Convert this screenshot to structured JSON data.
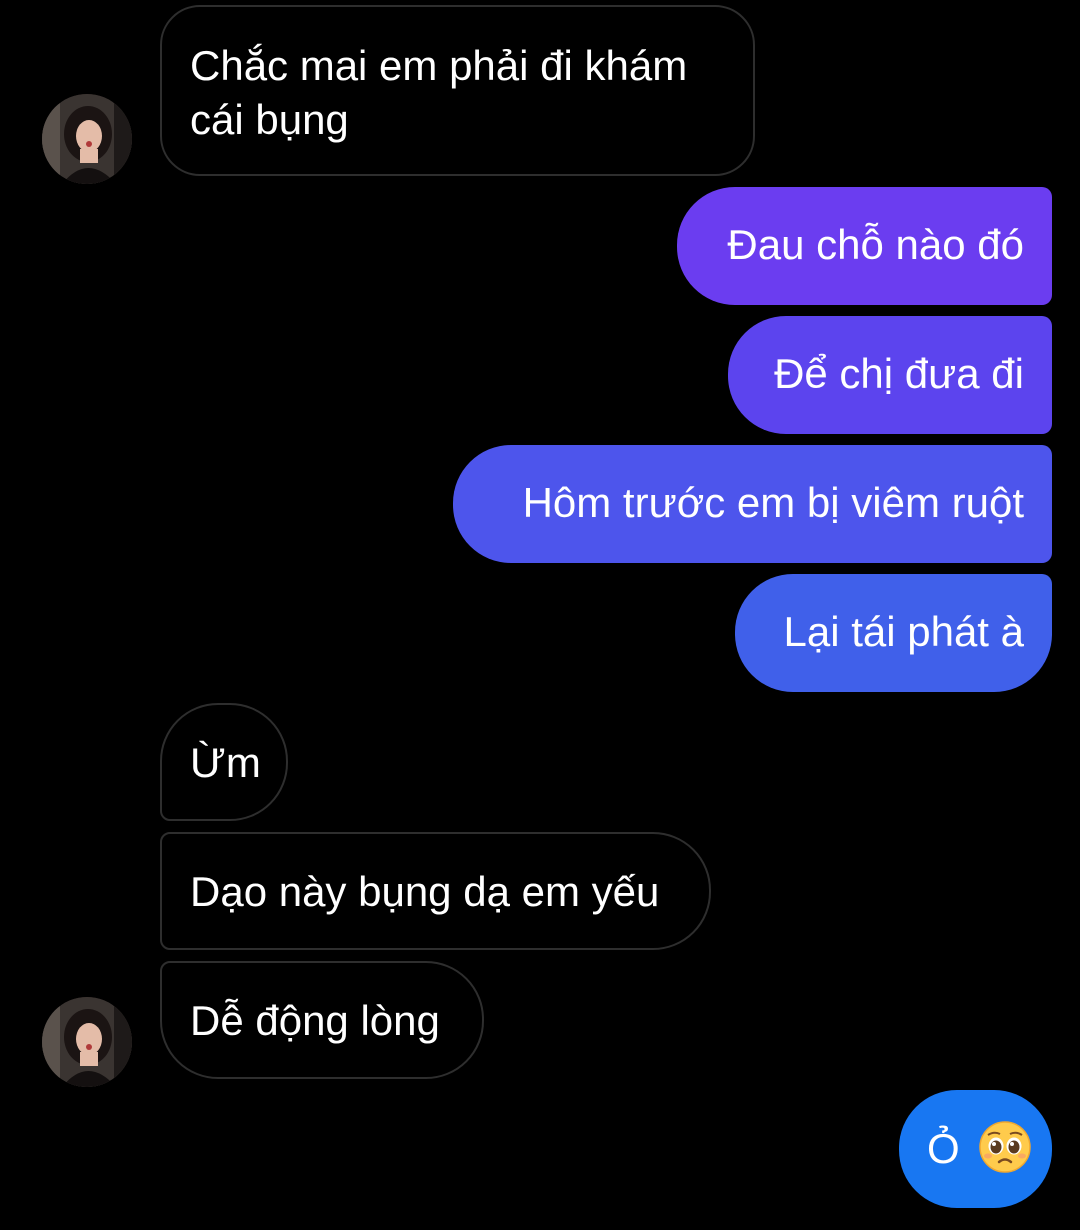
{
  "messages": [
    {
      "dir": "in",
      "text": "Chắc mai em phải đi khám cái bụng",
      "line1": "Chắc mai em phải đi khám",
      "line2": "cái bụng"
    },
    {
      "dir": "out",
      "text": "Đau chỗ nào đó"
    },
    {
      "dir": "out",
      "text": "Để chị đưa đi"
    },
    {
      "dir": "out",
      "text": "Hôm trước em bị viêm ruột"
    },
    {
      "dir": "out",
      "text": "Lại tái phát à"
    },
    {
      "dir": "in",
      "text": "Ừm"
    },
    {
      "dir": "in",
      "text": "Dạo này bụng dạ em yếu"
    },
    {
      "dir": "in",
      "text": "Dễ động lòng"
    },
    {
      "dir": "out",
      "text": "Ỏ",
      "emoji": "🥺"
    }
  ],
  "colors": {
    "background": "#000000",
    "incoming_border": "#2e2e2e",
    "out1": "#6b3df0",
    "out2": "#5c44ee",
    "out3": "#4d55ec",
    "out4": "#4060ea",
    "out5": "#1877f2"
  },
  "icons": {
    "avatar": "contact-avatar",
    "emoji": "pleading-face"
  }
}
